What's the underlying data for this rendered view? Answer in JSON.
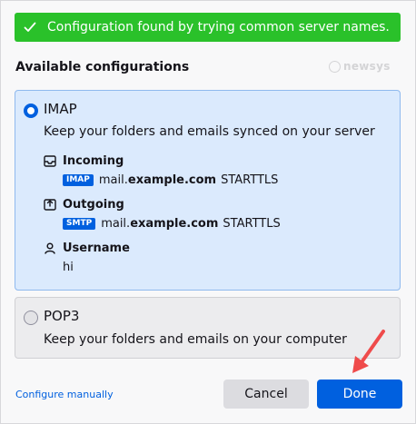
{
  "banner": {
    "message": "Configuration found by trying common server names.",
    "icon": "check-icon",
    "color": "#2ac12a"
  },
  "heading": "Available configurations",
  "watermark": "newsys",
  "configs": [
    {
      "protocol": "IMAP",
      "selected": true,
      "description": "Keep your folders and emails synced on your server",
      "incoming": {
        "label": "Incoming",
        "tag": "IMAP",
        "host_prefix": "mail.",
        "host_domain": "example.com",
        "security": "STARTTLS"
      },
      "outgoing": {
        "label": "Outgoing",
        "tag": "SMTP",
        "host_prefix": "mail.",
        "host_domain": "example.com",
        "security": "STARTTLS"
      },
      "username": {
        "label": "Username",
        "value": "hi"
      }
    },
    {
      "protocol": "POP3",
      "selected": false,
      "description": "Keep your folders and emails on your computer"
    }
  ],
  "footer": {
    "manual_link": "Configure manually",
    "cancel_label": "Cancel",
    "done_label": "Done"
  },
  "colors": {
    "accent": "#0060df",
    "selected_card": "#dbeafd",
    "annotation_arrow": "#ef4b4b"
  }
}
